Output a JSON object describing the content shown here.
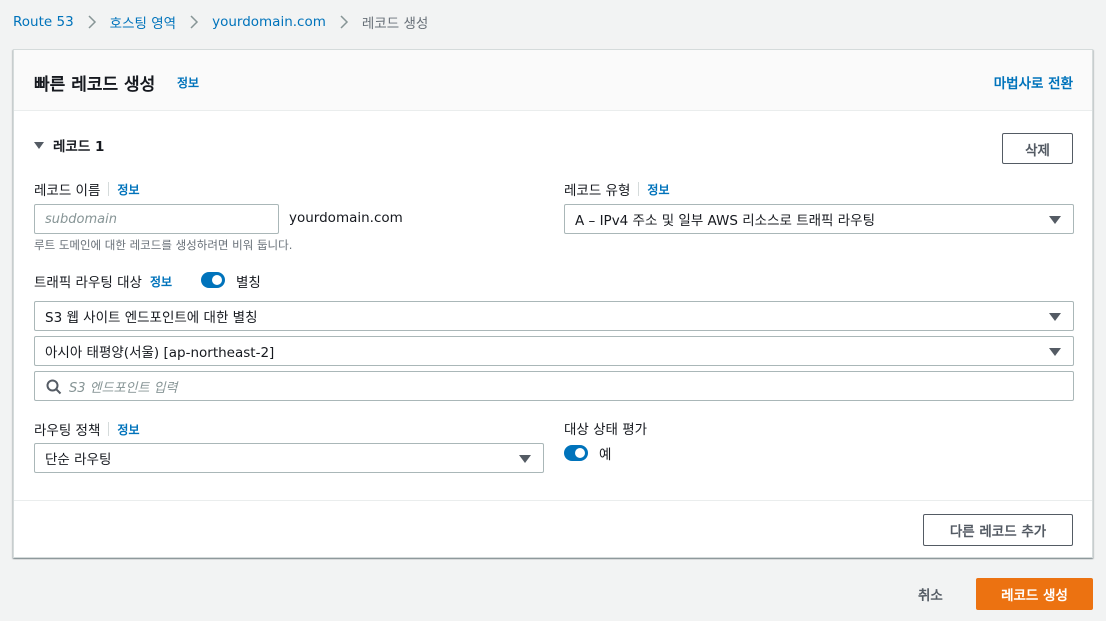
{
  "breadcrumb": {
    "items": [
      "Route 53",
      "호스팅 영역",
      "yourdomain.com"
    ],
    "current": "레코드 생성"
  },
  "panel": {
    "title": "빠른 레코드 생성",
    "info": "정보",
    "wizard_link": "마법사로 전환"
  },
  "record": {
    "section_label": "레코드 1",
    "delete_label": "삭제",
    "name": {
      "label": "레코드 이름",
      "info": "정보",
      "placeholder": "subdomain",
      "suffix": "yourdomain.com",
      "hint": "루트 도메인에 대한 레코드를 생성하려면 비워 둡니다."
    },
    "type": {
      "label": "레코드 유형",
      "info": "정보",
      "value": "A – IPv4 주소 및 일부 AWS 리소스로 트래픽 라우팅"
    },
    "route_target": {
      "label": "트래픽 라우팅 대상",
      "info": "정보",
      "alias_label": "별칭",
      "alias_on": true,
      "endpoint_type": "S3 웹 사이트 엔드포인트에 대한 별칭",
      "region": "아시아 태평양(서울) [ap-northeast-2]",
      "endpoint_placeholder": "S3 엔드포인트 입력"
    },
    "routing_policy": {
      "label": "라우팅 정책",
      "info": "정보",
      "value": "단순 라우팅"
    },
    "health_eval": {
      "label": "대상 상태 평가",
      "toggle_label": "예",
      "on": true
    },
    "add_record_label": "다른 레코드 추가"
  },
  "footer": {
    "cancel_label": "취소",
    "create_label": "레코드 생성"
  },
  "colors": {
    "link": "#0073bb",
    "primary": "#ec7211",
    "toggle_on": "#0073bb"
  }
}
